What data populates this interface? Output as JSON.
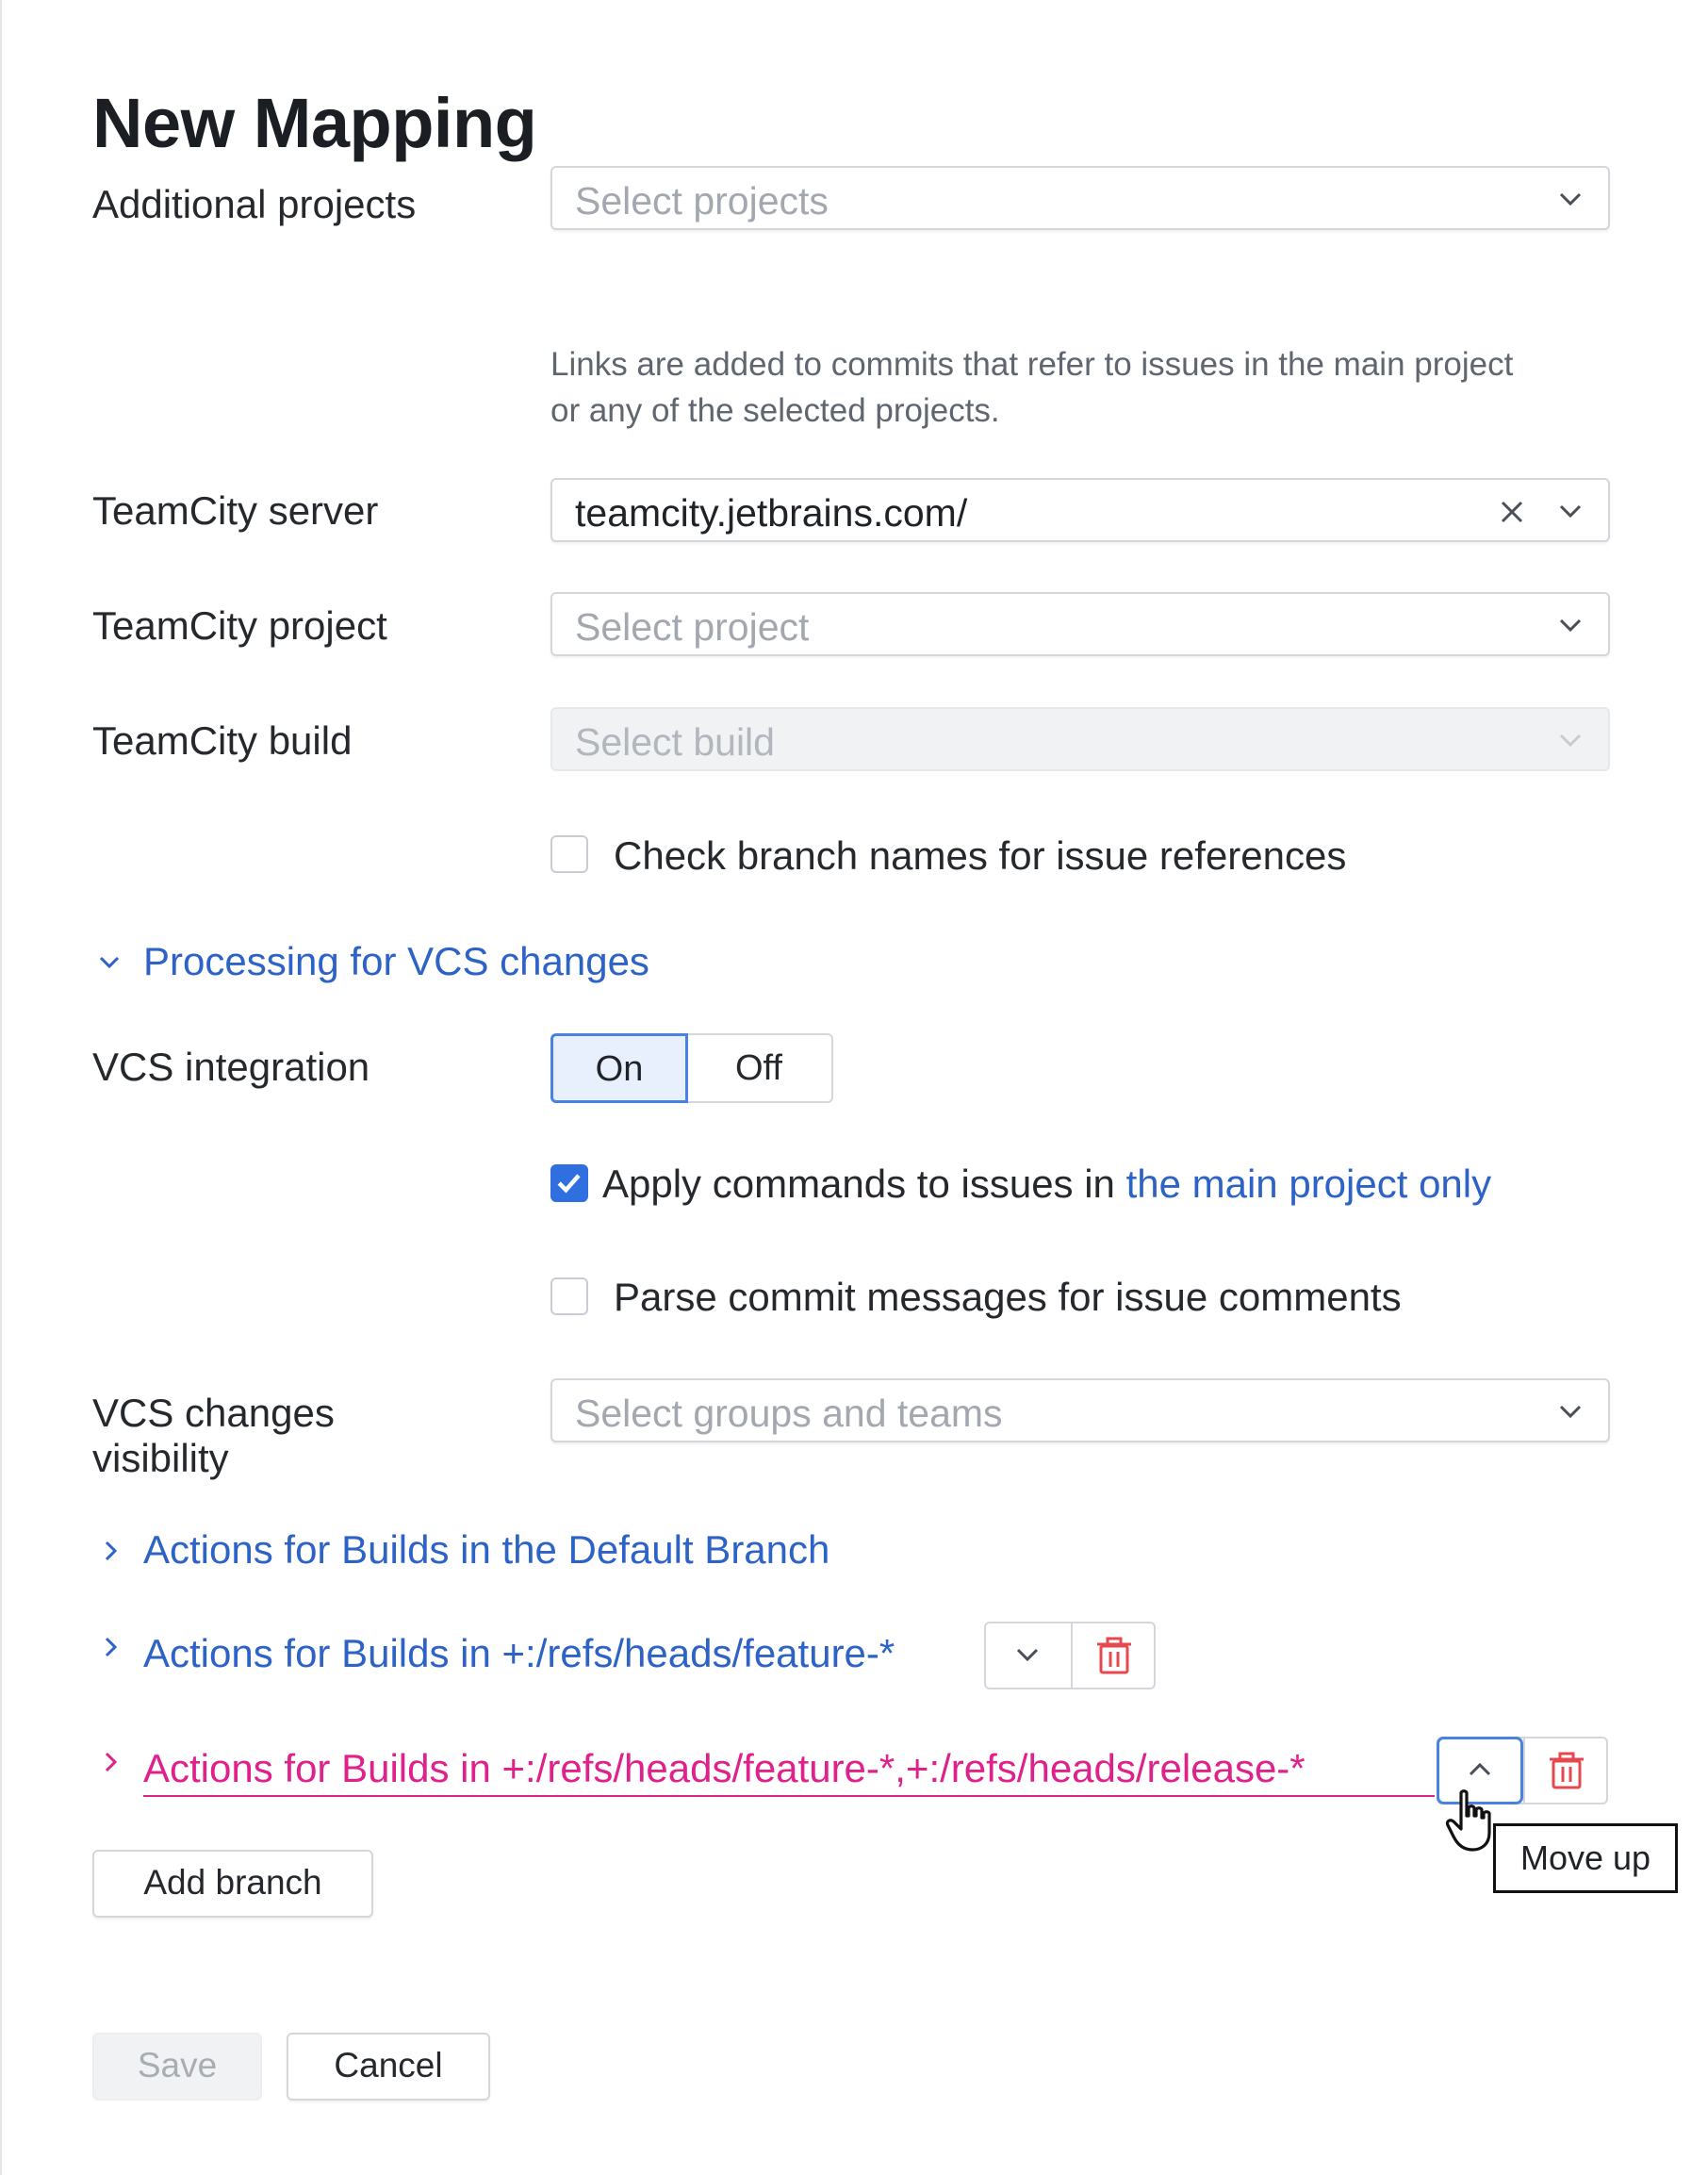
{
  "title": "New Mapping",
  "fields": {
    "additional_projects": {
      "label": "Additional projects",
      "placeholder": "Select projects",
      "hint_line1": "Links are added to commits that refer to issues in the main project",
      "hint_line2": "or any of the selected projects."
    },
    "teamcity_server": {
      "label": "TeamCity server",
      "value": "teamcity.jetbrains.com/"
    },
    "teamcity_project": {
      "label": "TeamCity project",
      "placeholder": "Select project"
    },
    "teamcity_build": {
      "label": "TeamCity build",
      "placeholder": "Select build",
      "disabled": true
    }
  },
  "check_branch_names": {
    "label": "Check branch names for issue references",
    "checked": false
  },
  "processing_section": {
    "title": "Processing for VCS changes",
    "expanded": true
  },
  "vcs_integration": {
    "label": "VCS integration",
    "on_label": "On",
    "off_label": "Off",
    "selected": "On"
  },
  "apply_commands": {
    "label_prefix": "Apply commands to issues in ",
    "label_link": "the main project only",
    "checked": true
  },
  "parse_commits": {
    "label": "Parse commit messages for issue comments",
    "checked": false
  },
  "vcs_visibility": {
    "label_line1": "VCS changes",
    "label_line2": "visibility",
    "placeholder": "Select groups and teams"
  },
  "branch_sections": [
    {
      "title": "Actions for Builds in the Default Branch"
    },
    {
      "title": "Actions for Builds in +:/refs/heads/feature-*"
    },
    {
      "title": "Actions for Builds in +:/refs/heads/feature-*,+:/refs/heads/release-*",
      "hovered": true
    }
  ],
  "tooltip": "Move up",
  "buttons": {
    "add_branch": "Add branch",
    "save": "Save",
    "cancel": "Cancel"
  },
  "colors": {
    "link": "#2d62c7",
    "accent": "#2f6fe0",
    "hover_pink": "#e0208b",
    "delete_red": "#e5484d"
  }
}
